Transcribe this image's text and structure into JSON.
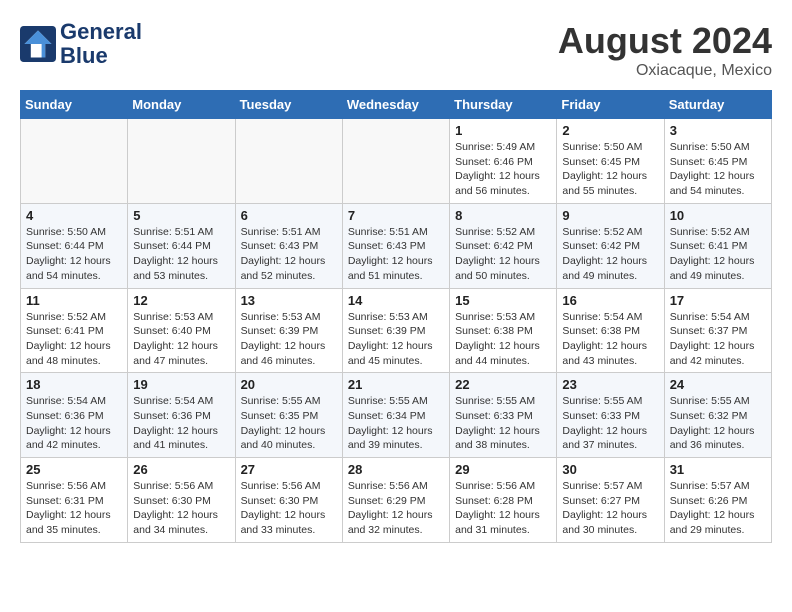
{
  "logo": {
    "name": "GeneralBlue",
    "line1": "General",
    "line2": "Blue"
  },
  "title": {
    "month_year": "August 2024",
    "location": "Oxiacaque, Mexico"
  },
  "days_of_week": [
    "Sunday",
    "Monday",
    "Tuesday",
    "Wednesday",
    "Thursday",
    "Friday",
    "Saturday"
  ],
  "weeks": [
    {
      "days": [
        {
          "num": "",
          "info": ""
        },
        {
          "num": "",
          "info": ""
        },
        {
          "num": "",
          "info": ""
        },
        {
          "num": "",
          "info": ""
        },
        {
          "num": "1",
          "info": "Sunrise: 5:49 AM\nSunset: 6:46 PM\nDaylight: 12 hours\nand 56 minutes."
        },
        {
          "num": "2",
          "info": "Sunrise: 5:50 AM\nSunset: 6:45 PM\nDaylight: 12 hours\nand 55 minutes."
        },
        {
          "num": "3",
          "info": "Sunrise: 5:50 AM\nSunset: 6:45 PM\nDaylight: 12 hours\nand 54 minutes."
        }
      ]
    },
    {
      "days": [
        {
          "num": "4",
          "info": "Sunrise: 5:50 AM\nSunset: 6:44 PM\nDaylight: 12 hours\nand 54 minutes."
        },
        {
          "num": "5",
          "info": "Sunrise: 5:51 AM\nSunset: 6:44 PM\nDaylight: 12 hours\nand 53 minutes."
        },
        {
          "num": "6",
          "info": "Sunrise: 5:51 AM\nSunset: 6:43 PM\nDaylight: 12 hours\nand 52 minutes."
        },
        {
          "num": "7",
          "info": "Sunrise: 5:51 AM\nSunset: 6:43 PM\nDaylight: 12 hours\nand 51 minutes."
        },
        {
          "num": "8",
          "info": "Sunrise: 5:52 AM\nSunset: 6:42 PM\nDaylight: 12 hours\nand 50 minutes."
        },
        {
          "num": "9",
          "info": "Sunrise: 5:52 AM\nSunset: 6:42 PM\nDaylight: 12 hours\nand 49 minutes."
        },
        {
          "num": "10",
          "info": "Sunrise: 5:52 AM\nSunset: 6:41 PM\nDaylight: 12 hours\nand 49 minutes."
        }
      ]
    },
    {
      "days": [
        {
          "num": "11",
          "info": "Sunrise: 5:52 AM\nSunset: 6:41 PM\nDaylight: 12 hours\nand 48 minutes."
        },
        {
          "num": "12",
          "info": "Sunrise: 5:53 AM\nSunset: 6:40 PM\nDaylight: 12 hours\nand 47 minutes."
        },
        {
          "num": "13",
          "info": "Sunrise: 5:53 AM\nSunset: 6:39 PM\nDaylight: 12 hours\nand 46 minutes."
        },
        {
          "num": "14",
          "info": "Sunrise: 5:53 AM\nSunset: 6:39 PM\nDaylight: 12 hours\nand 45 minutes."
        },
        {
          "num": "15",
          "info": "Sunrise: 5:53 AM\nSunset: 6:38 PM\nDaylight: 12 hours\nand 44 minutes."
        },
        {
          "num": "16",
          "info": "Sunrise: 5:54 AM\nSunset: 6:38 PM\nDaylight: 12 hours\nand 43 minutes."
        },
        {
          "num": "17",
          "info": "Sunrise: 5:54 AM\nSunset: 6:37 PM\nDaylight: 12 hours\nand 42 minutes."
        }
      ]
    },
    {
      "days": [
        {
          "num": "18",
          "info": "Sunrise: 5:54 AM\nSunset: 6:36 PM\nDaylight: 12 hours\nand 42 minutes."
        },
        {
          "num": "19",
          "info": "Sunrise: 5:54 AM\nSunset: 6:36 PM\nDaylight: 12 hours\nand 41 minutes."
        },
        {
          "num": "20",
          "info": "Sunrise: 5:55 AM\nSunset: 6:35 PM\nDaylight: 12 hours\nand 40 minutes."
        },
        {
          "num": "21",
          "info": "Sunrise: 5:55 AM\nSunset: 6:34 PM\nDaylight: 12 hours\nand 39 minutes."
        },
        {
          "num": "22",
          "info": "Sunrise: 5:55 AM\nSunset: 6:33 PM\nDaylight: 12 hours\nand 38 minutes."
        },
        {
          "num": "23",
          "info": "Sunrise: 5:55 AM\nSunset: 6:33 PM\nDaylight: 12 hours\nand 37 minutes."
        },
        {
          "num": "24",
          "info": "Sunrise: 5:55 AM\nSunset: 6:32 PM\nDaylight: 12 hours\nand 36 minutes."
        }
      ]
    },
    {
      "days": [
        {
          "num": "25",
          "info": "Sunrise: 5:56 AM\nSunset: 6:31 PM\nDaylight: 12 hours\nand 35 minutes."
        },
        {
          "num": "26",
          "info": "Sunrise: 5:56 AM\nSunset: 6:30 PM\nDaylight: 12 hours\nand 34 minutes."
        },
        {
          "num": "27",
          "info": "Sunrise: 5:56 AM\nSunset: 6:30 PM\nDaylight: 12 hours\nand 33 minutes."
        },
        {
          "num": "28",
          "info": "Sunrise: 5:56 AM\nSunset: 6:29 PM\nDaylight: 12 hours\nand 32 minutes."
        },
        {
          "num": "29",
          "info": "Sunrise: 5:56 AM\nSunset: 6:28 PM\nDaylight: 12 hours\nand 31 minutes."
        },
        {
          "num": "30",
          "info": "Sunrise: 5:57 AM\nSunset: 6:27 PM\nDaylight: 12 hours\nand 30 minutes."
        },
        {
          "num": "31",
          "info": "Sunrise: 5:57 AM\nSunset: 6:26 PM\nDaylight: 12 hours\nand 29 minutes."
        }
      ]
    }
  ]
}
